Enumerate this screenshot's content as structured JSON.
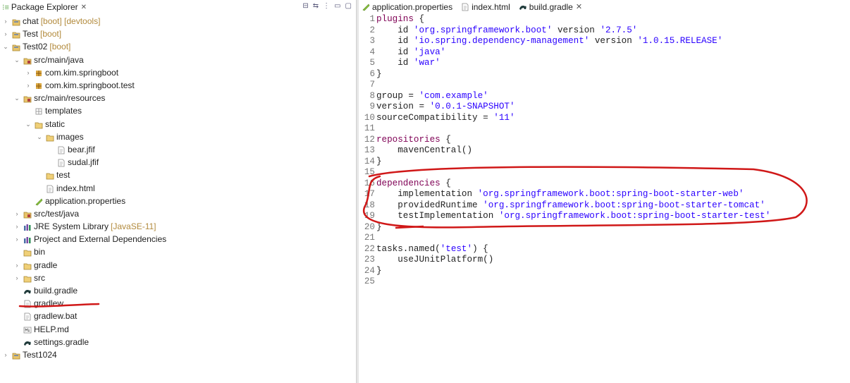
{
  "explorer": {
    "title": "Package Explorer",
    "close": "✕",
    "tree": [
      {
        "name": "chat",
        "dec": "[boot] [devtools]",
        "depth": 0,
        "icon": "project",
        "twisty": "›"
      },
      {
        "name": "Test",
        "dec": "[boot]",
        "depth": 0,
        "icon": "project",
        "twisty": "›"
      },
      {
        "name": "Test02",
        "dec": "[boot]",
        "depth": 0,
        "icon": "project",
        "twisty": "⌄"
      },
      {
        "name": "src/main/java",
        "dec": "",
        "depth": 1,
        "icon": "srcfolder",
        "twisty": "⌄"
      },
      {
        "name": "com.kim.springboot",
        "dec": "",
        "depth": 2,
        "icon": "package",
        "twisty": "›"
      },
      {
        "name": "com.kim.springboot.test",
        "dec": "",
        "depth": 2,
        "icon": "package",
        "twisty": "›"
      },
      {
        "name": "src/main/resources",
        "dec": "",
        "depth": 1,
        "icon": "srcfolder",
        "twisty": "⌄"
      },
      {
        "name": "templates",
        "dec": "",
        "depth": 2,
        "icon": "emptypkg",
        "twisty": ""
      },
      {
        "name": "static",
        "dec": "",
        "depth": 2,
        "icon": "folder",
        "twisty": "⌄"
      },
      {
        "name": "images",
        "dec": "",
        "depth": 3,
        "icon": "folder",
        "twisty": "⌄"
      },
      {
        "name": "bear.jfif",
        "dec": "",
        "depth": 4,
        "icon": "file",
        "twisty": ""
      },
      {
        "name": "sudal.jfif",
        "dec": "",
        "depth": 4,
        "icon": "file",
        "twisty": ""
      },
      {
        "name": "test",
        "dec": "",
        "depth": 3,
        "icon": "folder",
        "twisty": ""
      },
      {
        "name": "index.html",
        "dec": "",
        "depth": 3,
        "icon": "file",
        "twisty": ""
      },
      {
        "name": "application.properties",
        "dec": "",
        "depth": 2,
        "icon": "props",
        "twisty": ""
      },
      {
        "name": "src/test/java",
        "dec": "",
        "depth": 1,
        "icon": "srcfolder",
        "twisty": "›"
      },
      {
        "name": "JRE System Library",
        "dec": "[JavaSE-11]",
        "depth": 1,
        "icon": "library",
        "twisty": "›"
      },
      {
        "name": "Project and External Dependencies",
        "dec": "",
        "depth": 1,
        "icon": "library",
        "twisty": "›"
      },
      {
        "name": "bin",
        "dec": "",
        "depth": 1,
        "icon": "folder",
        "twisty": ""
      },
      {
        "name": "gradle",
        "dec": "",
        "depth": 1,
        "icon": "folder",
        "twisty": "›"
      },
      {
        "name": "src",
        "dec": "",
        "depth": 1,
        "icon": "folder",
        "twisty": "›"
      },
      {
        "name": "build.gradle",
        "dec": "",
        "depth": 1,
        "icon": "gradle",
        "twisty": ""
      },
      {
        "name": "gradlew",
        "dec": "",
        "depth": 1,
        "icon": "file",
        "twisty": ""
      },
      {
        "name": "gradlew.bat",
        "dec": "",
        "depth": 1,
        "icon": "file",
        "twisty": ""
      },
      {
        "name": "HELP.md",
        "dec": "",
        "depth": 1,
        "icon": "md",
        "twisty": ""
      },
      {
        "name": "settings.gradle",
        "dec": "",
        "depth": 1,
        "icon": "gradle",
        "twisty": ""
      },
      {
        "name": "Test1024",
        "dec": "",
        "depth": 0,
        "icon": "project",
        "twisty": "›"
      }
    ]
  },
  "editor": {
    "tabs": [
      {
        "label": "application.properties",
        "icon": "props",
        "active": false
      },
      {
        "label": "index.html",
        "icon": "file",
        "active": false
      },
      {
        "label": "build.gradle",
        "icon": "gradle",
        "active": true,
        "close": "✕"
      }
    ],
    "lines": [
      [
        [
          "kw",
          "plugins"
        ],
        [
          "txt",
          " {"
        ]
      ],
      [
        [
          "txt",
          "    id "
        ],
        [
          "str",
          "'org.springframework.boot'"
        ],
        [
          "txt",
          " version "
        ],
        [
          "str",
          "'2.7.5'"
        ]
      ],
      [
        [
          "txt",
          "    id "
        ],
        [
          "str",
          "'io.spring.dependency-management'"
        ],
        [
          "txt",
          " version "
        ],
        [
          "str",
          "'1.0.15.RELEASE'"
        ]
      ],
      [
        [
          "txt",
          "    id "
        ],
        [
          "str",
          "'java'"
        ]
      ],
      [
        [
          "txt",
          "    id "
        ],
        [
          "str",
          "'war'"
        ]
      ],
      [
        [
          "txt",
          "}"
        ]
      ],
      [
        [
          "txt",
          ""
        ]
      ],
      [
        [
          "txt",
          "group = "
        ],
        [
          "str",
          "'com.example'"
        ]
      ],
      [
        [
          "txt",
          "version = "
        ],
        [
          "str",
          "'0.0.1-SNAPSHOT'"
        ]
      ],
      [
        [
          "txt",
          "sourceCompatibility = "
        ],
        [
          "str",
          "'11'"
        ]
      ],
      [
        [
          "txt",
          ""
        ]
      ],
      [
        [
          "kw",
          "repositories"
        ],
        [
          "txt",
          " {"
        ]
      ],
      [
        [
          "txt",
          "    mavenCentral()"
        ]
      ],
      [
        [
          "txt",
          "}"
        ]
      ],
      [
        [
          "txt",
          ""
        ]
      ],
      [
        [
          "kw",
          "dependencies"
        ],
        [
          "txt",
          " {"
        ]
      ],
      [
        [
          "txt",
          "    implementation "
        ],
        [
          "str",
          "'org.springframework.boot:spring-boot-starter-web'"
        ]
      ],
      [
        [
          "txt",
          "    providedRuntime "
        ],
        [
          "str",
          "'org.springframework.boot:spring-boot-starter-tomcat'"
        ]
      ],
      [
        [
          "txt",
          "    testImplementation "
        ],
        [
          "str",
          "'org.springframework.boot:spring-boot-starter-test'"
        ]
      ],
      [
        [
          "txt",
          "}"
        ]
      ],
      [
        [
          "txt",
          ""
        ]
      ],
      [
        [
          "txt",
          "tasks.named("
        ],
        [
          "str",
          "'test'"
        ],
        [
          "txt",
          ") {"
        ]
      ],
      [
        [
          "txt",
          "    useJUnitPlatform()"
        ]
      ],
      [
        [
          "txt",
          "}"
        ]
      ],
      [
        [
          "txt",
          ""
        ]
      ]
    ],
    "fold_lines": [
      1,
      6,
      8,
      12,
      14,
      16,
      20,
      22,
      24
    ]
  },
  "colors": {
    "annotation": "#d01818",
    "keyword": "#7f0055",
    "string": "#2a00ff",
    "decoration": "#b28a3c"
  }
}
